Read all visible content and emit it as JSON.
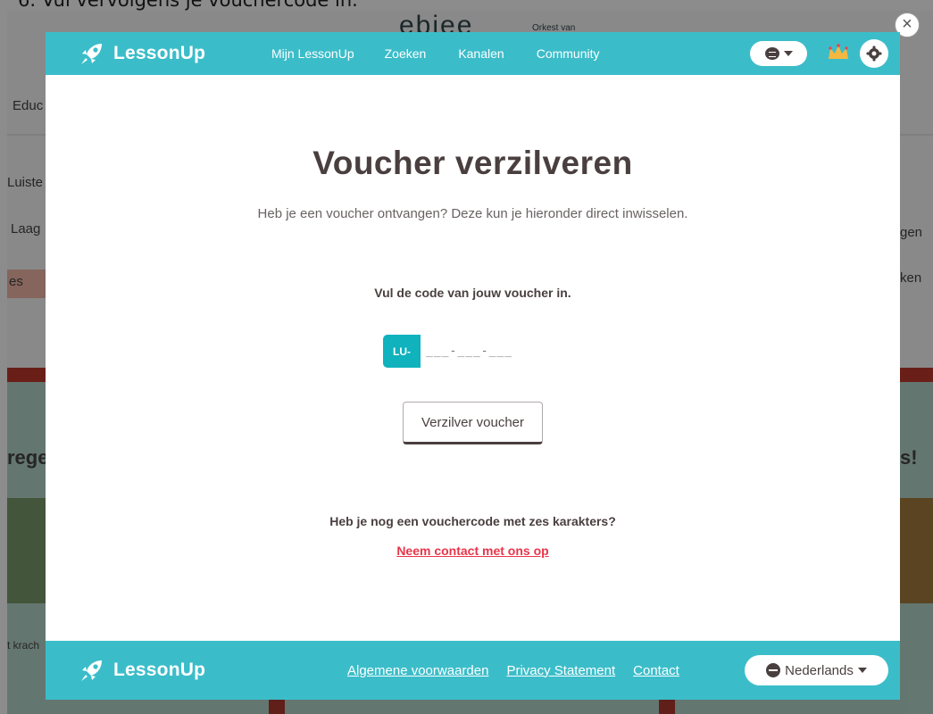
{
  "background": {
    "caption": "6.  Vul vervolgens je vouchercode in.",
    "logo": "ebiee",
    "logo_sub": "Orkest van",
    "left_fragments": [
      "Educ",
      "Luiste",
      "Laag",
      "es",
      "rege",
      "t krach"
    ],
    "right_fragments": [
      "gen",
      "ken",
      "s!"
    ]
  },
  "close_label": "×",
  "topbar": {
    "brand": "LessonUp",
    "nav": [
      "Mijn LessonUp",
      "Zoeken",
      "Kanalen",
      "Community"
    ]
  },
  "voucher": {
    "title": "Voucher verzilveren",
    "subtitle": "Heb je een voucher ontvangen? Deze kun je hieronder direct inwisselen.",
    "code_label": "Vul de code van jouw voucher in.",
    "code_prefix": "LU-",
    "code_placeholder": "___-___-___",
    "redeem_button": "Verzilver voucher",
    "six_char_question": "Heb je nog een vouchercode met zes karakters?",
    "contact_link": "Neem contact met ons op"
  },
  "footer": {
    "brand": "LessonUp",
    "links": [
      "Algemene voorwaarden",
      "Privacy Statement",
      "Contact"
    ],
    "language": "Nederlands"
  },
  "colors": {
    "teal": "#3bbdc9",
    "code_prefix_teal": "#0fb2bd",
    "heading_brown": "#4a3f3f",
    "link_red": "#e8364a",
    "support_red": "#e8444e"
  },
  "icons": [
    "rocket-icon",
    "chat-bubble-icon",
    "chevron-down-icon",
    "crown-icon",
    "gear-icon",
    "close-icon",
    "support-chat-icon",
    "globe-icon"
  ]
}
